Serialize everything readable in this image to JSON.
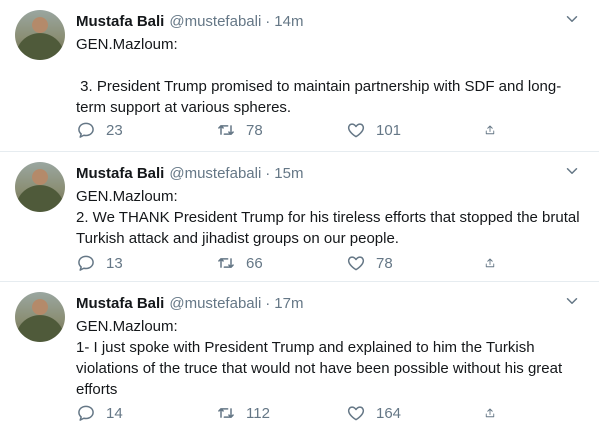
{
  "tweets": [
    {
      "name": "Mustafa Bali",
      "handle": "@mustefabali",
      "separator": "·",
      "time": "14m",
      "text": "GEN.Mazloum:\n\n 3. President Trump promised to maintain partnership with SDF and long-term support at various spheres.",
      "replies": "23",
      "retweets": "78",
      "likes": "101"
    },
    {
      "name": "Mustafa Bali",
      "handle": "@mustefabali",
      "separator": "·",
      "time": "15m",
      "text": "GEN.Mazloum:\n2. We THANK President Trump for his tireless efforts that stopped the brutal Turkish attack and jihadist groups on our people.",
      "replies": "13",
      "retweets": "66",
      "likes": "78"
    },
    {
      "name": "Mustafa Bali",
      "handle": "@mustefabali",
      "separator": "·",
      "time": "17m",
      "text": "GEN.Mazloum:\n1- I just spoke with President Trump and explained to him the Turkish violations of the truce that would not have been possible without his great efforts",
      "replies": "14",
      "retweets": "112",
      "likes": "164"
    }
  ],
  "icons": {
    "reply": "reply-icon",
    "retweet": "retweet-icon",
    "like": "heart-icon",
    "share": "share-icon",
    "caret": "chevron-down-icon"
  },
  "colors": {
    "text": "#14171a",
    "muted": "#657786",
    "divider": "#e6ecf0"
  }
}
